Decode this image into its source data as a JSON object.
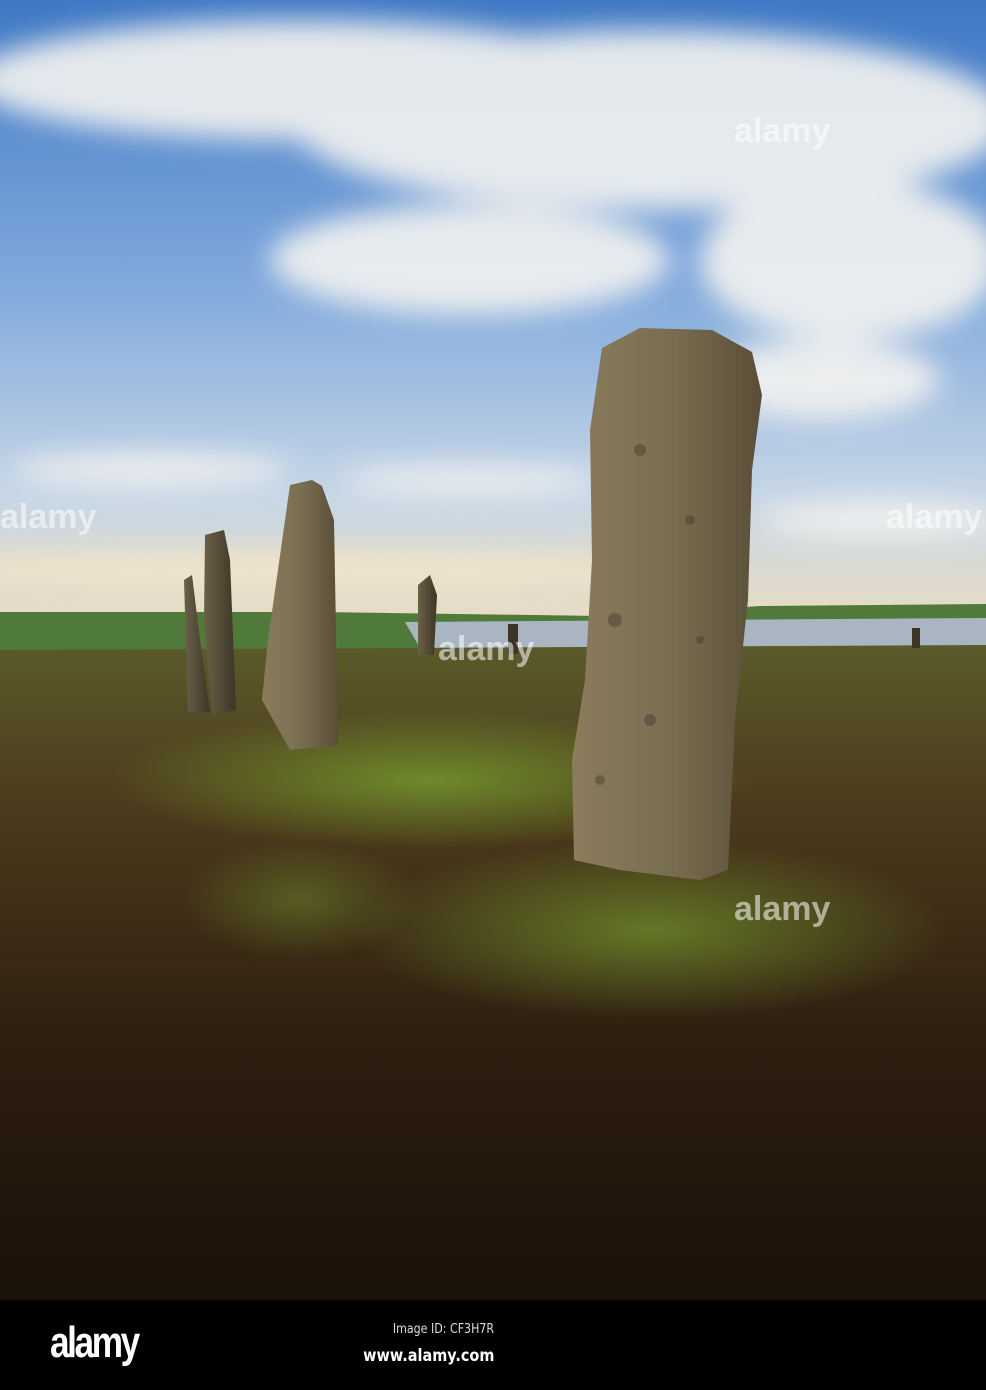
{
  "photo": {
    "subject": "standing-stones",
    "watermark": "alamy"
  },
  "footer": {
    "logo": "alamy",
    "image_id": "Image ID: CF3H7R",
    "url": "www.alamy.com"
  }
}
